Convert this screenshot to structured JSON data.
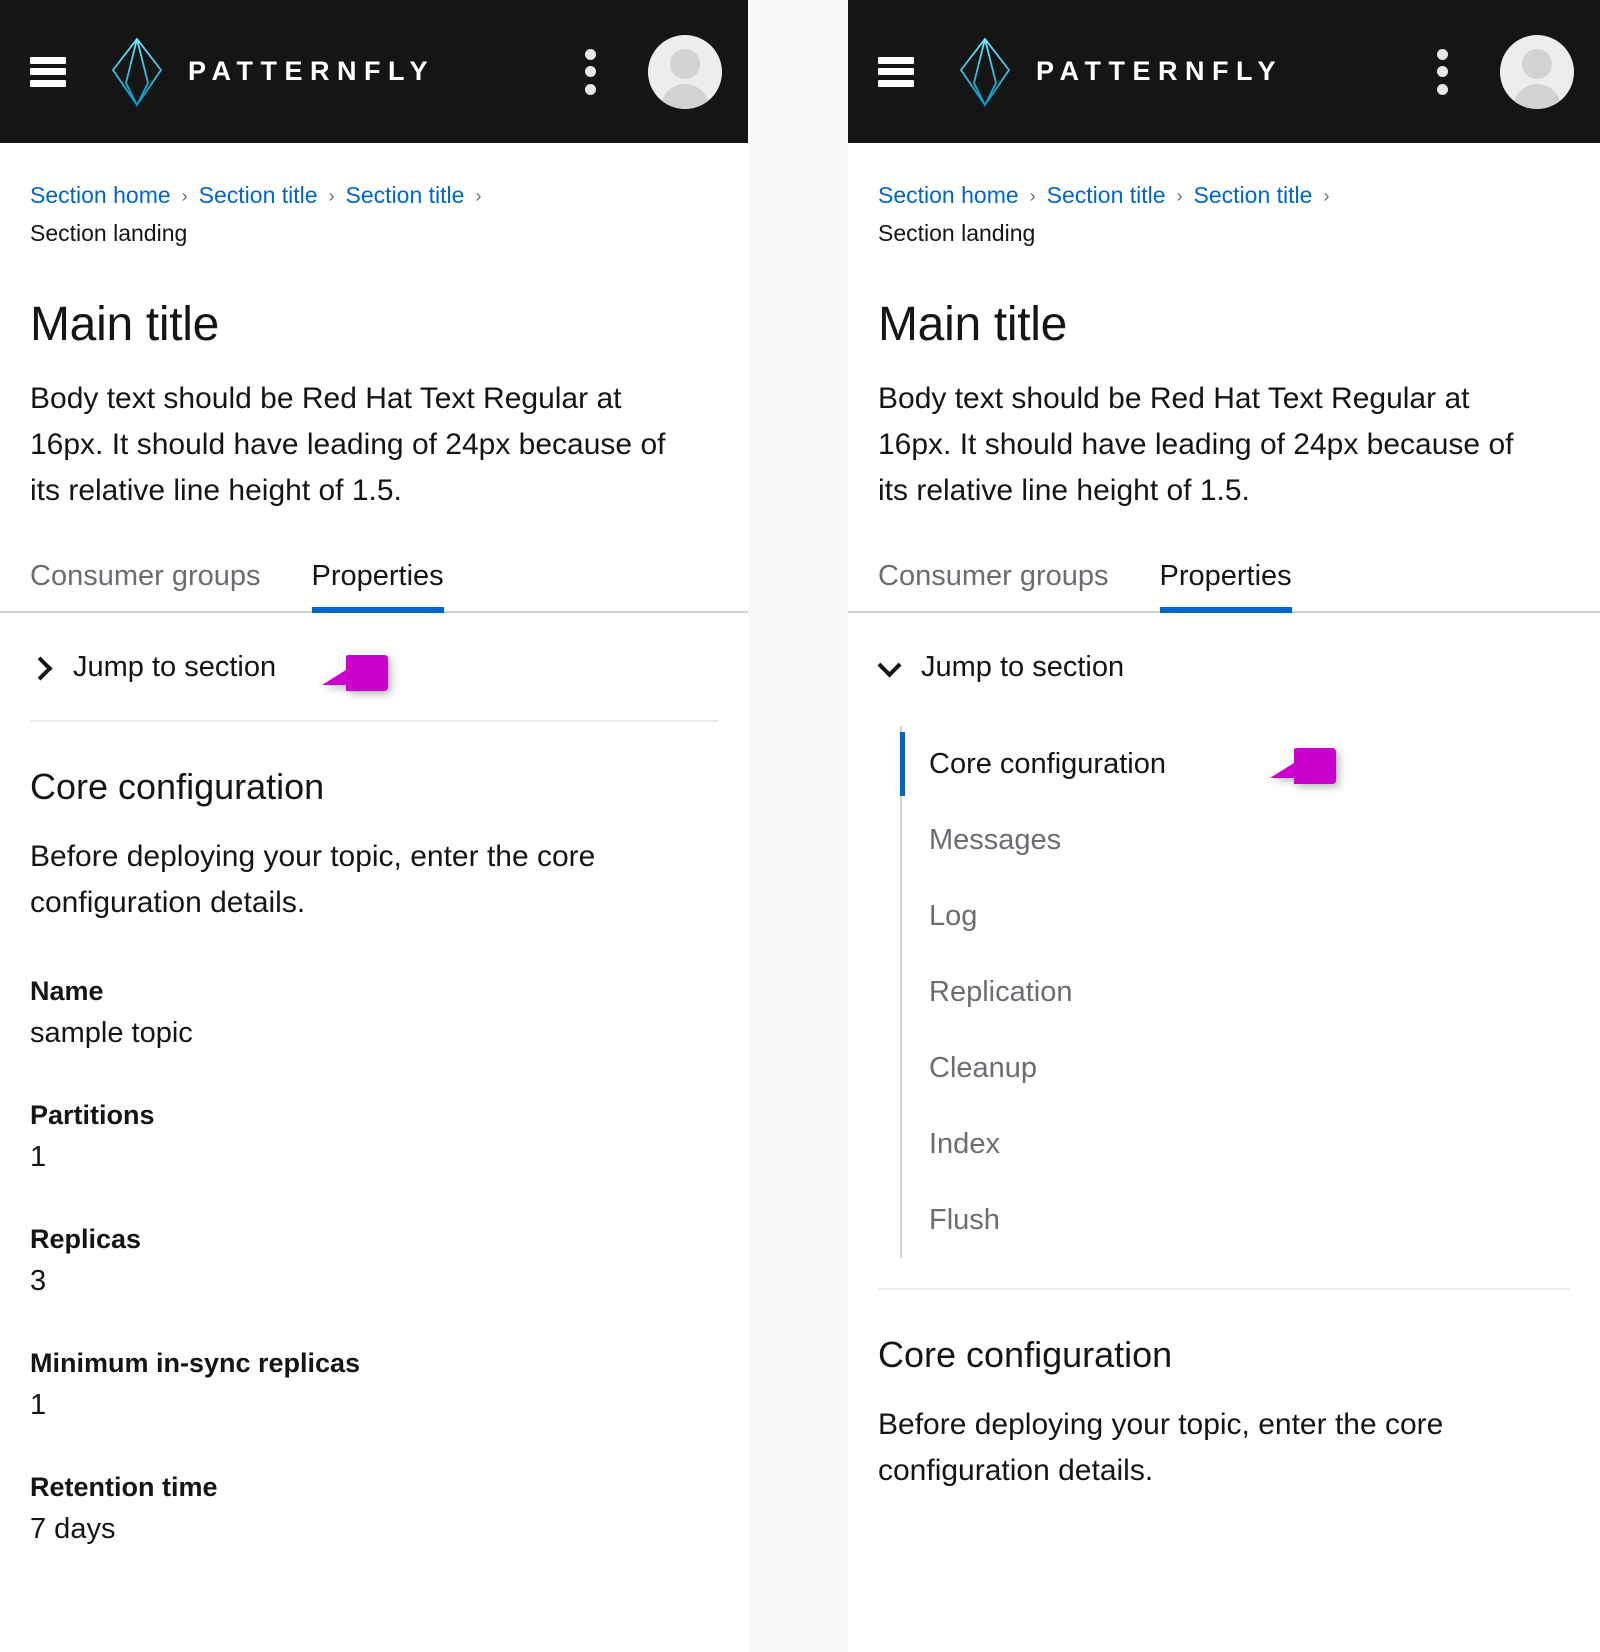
{
  "masthead": {
    "menu_icon": "hamburger-icon",
    "logo_icon": "patternfly-logo-icon",
    "brand": "PATTERNFLY",
    "kebab_icon": "kebab-menu-icon",
    "avatar_icon": "user-avatar-icon"
  },
  "breadcrumb": {
    "items": [
      "Section home",
      "Section title",
      "Section title"
    ],
    "current": "Section landing",
    "separator": "›"
  },
  "page": {
    "title": "Main title",
    "body": "Body text should be Red Hat Text Regular at 16px. It should have leading of 24px because of its relative line height of 1.5."
  },
  "tabs": [
    {
      "label": "Consumer groups",
      "active": false
    },
    {
      "label": "Properties",
      "active": true
    }
  ],
  "jump": {
    "label": "Jump to section",
    "collapsed_icon": "chevron-right-icon",
    "expanded_icon": "chevron-down-icon",
    "items": [
      {
        "label": "Core configuration",
        "active": true
      },
      {
        "label": "Messages",
        "active": false
      },
      {
        "label": "Log",
        "active": false
      },
      {
        "label": "Replication",
        "active": false
      },
      {
        "label": "Cleanup",
        "active": false
      },
      {
        "label": "Index",
        "active": false
      },
      {
        "label": "Flush",
        "active": false
      }
    ]
  },
  "section": {
    "title": "Core configuration",
    "description": "Before deploying your topic, enter the core configuration details."
  },
  "details": [
    {
      "term": "Name",
      "value": "sample topic"
    },
    {
      "term": "Partitions",
      "value": "1"
    },
    {
      "term": "Replicas",
      "value": "3"
    },
    {
      "term": "Minimum in-sync replicas",
      "value": "1"
    },
    {
      "term": "Retention time",
      "value": "7 days"
    }
  ],
  "annotation": {
    "pointer_icon": "magenta-pointer-arrow",
    "color": "#cc00cc"
  },
  "colors": {
    "masthead_bg": "#151515",
    "link": "#0066cc",
    "accent": "#0066cc",
    "muted_text": "#6a6e73",
    "brand_logo": "#00b9e4",
    "page_bg": "#f9f9f9"
  }
}
